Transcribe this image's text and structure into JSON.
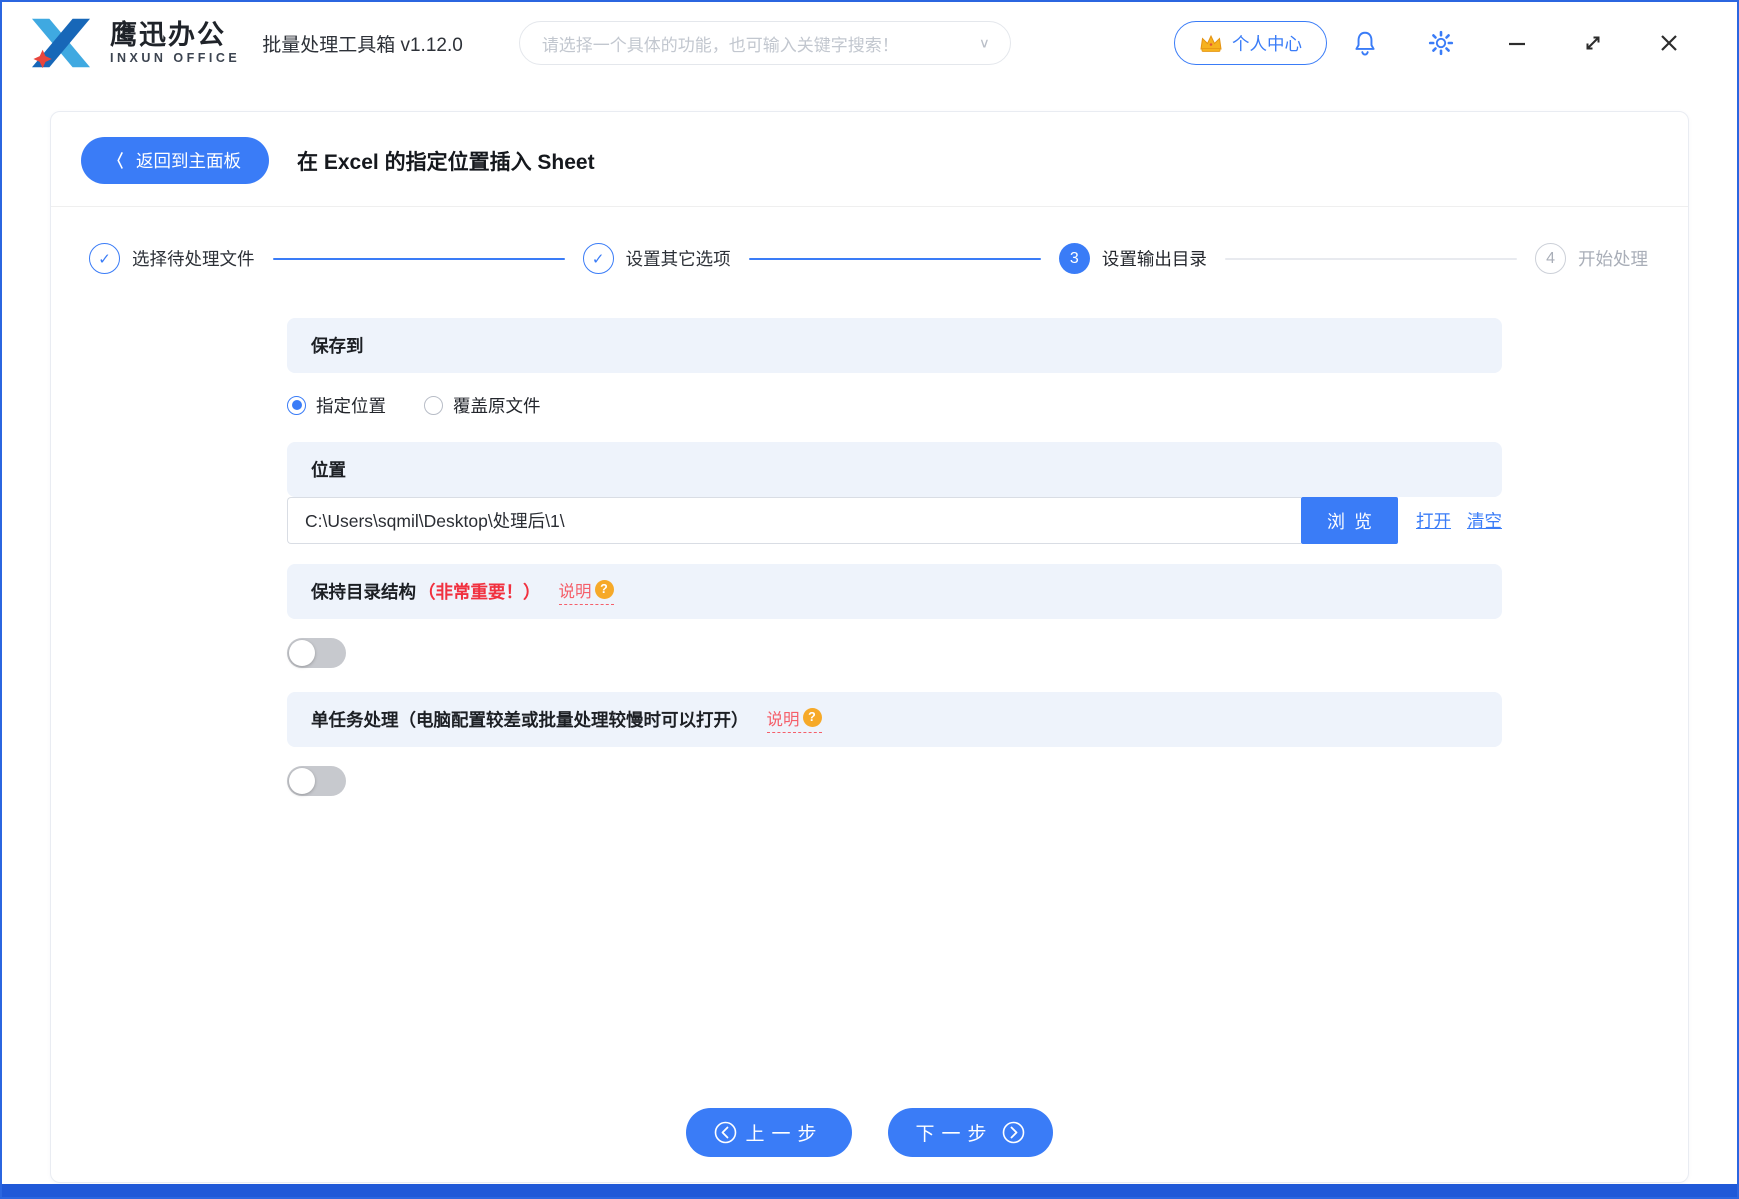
{
  "header": {
    "brand": "鹰迅办公",
    "brand_sub": "INXUN OFFICE",
    "app_title": "批量处理工具箱 v1.12.0",
    "search_placeholder": "请选择一个具体的功能，也可输入关键字搜索！",
    "user_center_label": "个人中心"
  },
  "page": {
    "back_label": "返回到主面板",
    "back_chevron": "〈",
    "title": "在 Excel 的指定位置插入 Sheet"
  },
  "stepper": {
    "steps": [
      {
        "label": "选择待处理文件",
        "state": "done",
        "mark": "✓"
      },
      {
        "label": "设置其它选项",
        "state": "done",
        "mark": "✓"
      },
      {
        "label": "设置输出目录",
        "state": "active",
        "number": "3"
      },
      {
        "label": "开始处理",
        "state": "pending",
        "number": "4"
      }
    ]
  },
  "form": {
    "help_badge": "?",
    "save_to": {
      "title": "保存到",
      "options": [
        {
          "label": "指定位置",
          "selected": true
        },
        {
          "label": "覆盖原文件",
          "selected": false
        }
      ]
    },
    "location": {
      "title": "位置",
      "path": "C:\\Users\\sqmil\\Desktop\\处理后\\1\\",
      "browse_label": "浏览",
      "open_label": "打开",
      "clear_label": "清空"
    },
    "keep_structure": {
      "title": "保持目录结构",
      "important": "（非常重要！）",
      "help_label": "说明",
      "enabled": false
    },
    "single_task": {
      "title": "单任务处理（电脑配置较差或批量处理较慢时可以打开）",
      "help_label": "说明",
      "enabled": false
    }
  },
  "footer": {
    "prev_label": "上一步",
    "next_label": "下一步"
  },
  "colors": {
    "primary": "#3a7cf7",
    "section_bg": "#eef3fb",
    "danger_red": "#f1303f",
    "badge_orange": "#f6a928",
    "window_border": "#2b66e0"
  }
}
